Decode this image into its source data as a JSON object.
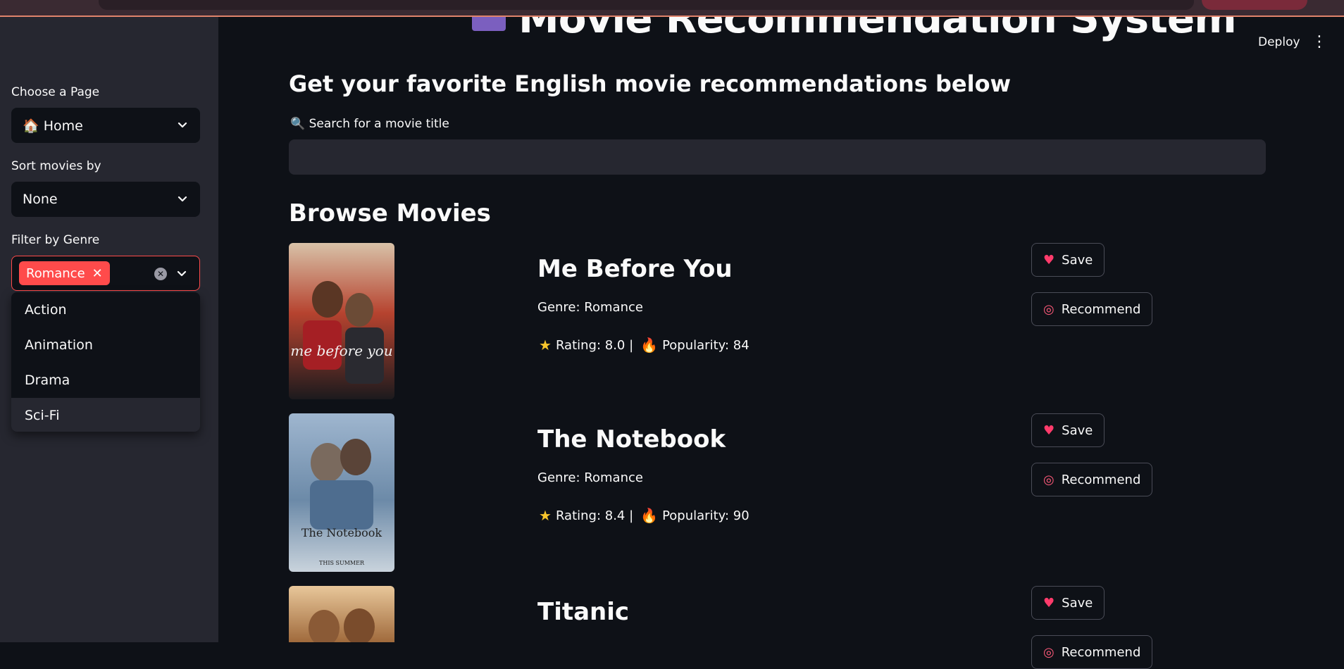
{
  "app": {
    "title": "Movie Recommendation System",
    "deploy_label": "Deploy",
    "menu_label": "⋮"
  },
  "sidebar": {
    "page_label": "Choose a Page",
    "page_value": "🏠 Home",
    "sort_label": "Sort movies by",
    "sort_value": "None",
    "genre_label": "Filter by Genre",
    "genre_selected": "Romance",
    "genre_options": [
      "Action",
      "Animation",
      "Drama",
      "Sci-Fi"
    ]
  },
  "main": {
    "subheading": "Get your favorite English movie recommendations below",
    "search_label": "🔍 Search for a movie title",
    "search_value": "",
    "section_title": "Browse Movies"
  },
  "buttons": {
    "save": "Save",
    "recommend": "Recommend"
  },
  "movies": [
    {
      "title": "Me Before You",
      "genre": "Genre: Romance",
      "rating": "Rating: 8.0 |",
      "popularity": "Popularity: 84",
      "poster_text": "me before you"
    },
    {
      "title": "The Notebook",
      "genre": "Genre: Romance",
      "rating": "Rating: 8.4 |",
      "popularity": "Popularity: 90",
      "poster_text": "The Notebook",
      "poster_sub": "THIS SUMMER"
    },
    {
      "title": "Titanic"
    }
  ],
  "colors": {
    "background": "#0e1117",
    "sidebar": "#262730",
    "accent": "#ff4b4b"
  }
}
